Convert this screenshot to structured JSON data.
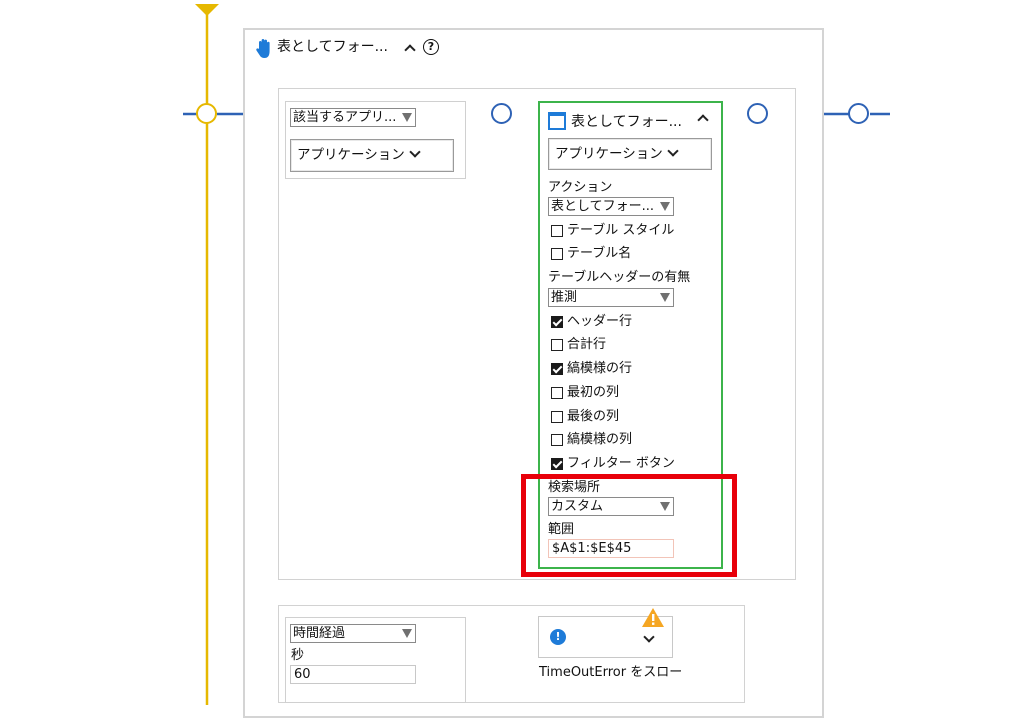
{
  "outer_block": {
    "title": "表としてフォー...",
    "icon": "hand-icon",
    "help": "?"
  },
  "condition": {
    "select_value": "該当するアプリ...",
    "app_button": "アプリケーション"
  },
  "action_card": {
    "title": "表としてフォー...",
    "app_button": "アプリケーション",
    "action_label": "アクション",
    "action_value": "表としてフォー...",
    "options_a": [
      {
        "label": "テーブル スタイル",
        "checked": false
      },
      {
        "label": "テーブル名",
        "checked": false
      }
    ],
    "header_label": "テーブルヘッダーの有無",
    "header_value": "推測",
    "options_b": [
      {
        "label": "ヘッダー行",
        "checked": true
      },
      {
        "label": "合計行",
        "checked": false
      },
      {
        "label": "縞模様の行",
        "checked": true
      },
      {
        "label": "最初の列",
        "checked": false
      },
      {
        "label": "最後の列",
        "checked": false
      },
      {
        "label": "縞模様の列",
        "checked": false
      },
      {
        "label": "フィルター ボタン",
        "checked": true
      }
    ],
    "search_label": "検索場所",
    "search_value": "カスタム",
    "range_label": "範囲",
    "range_value": "$A$1:$E$45"
  },
  "timeout": {
    "select_value": "時間経過",
    "seconds_label": "秒",
    "seconds_value": "60",
    "error_caption": "TimeOutError をスロー"
  },
  "colors": {
    "flow_blue": "#2e62b5",
    "flow_yellow": "#e6b800",
    "highlight_red": "#e8000a",
    "card_green": "#3cb44b",
    "info_blue": "#1e7bd8",
    "warning_orange": "#f5a623"
  }
}
